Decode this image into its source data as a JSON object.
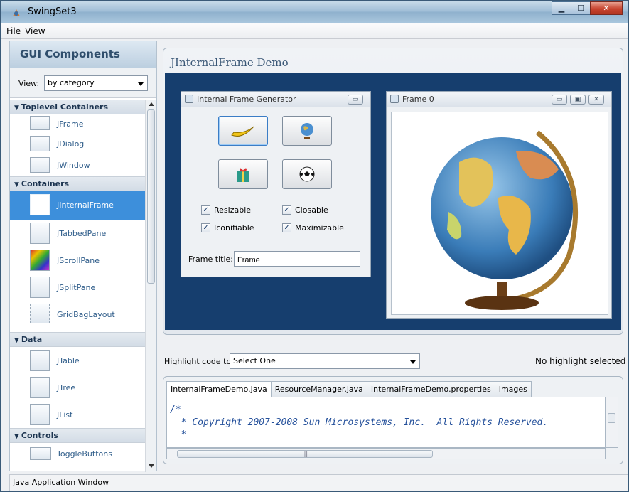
{
  "window": {
    "title": "SwingSet3"
  },
  "menu": [
    "File",
    "View"
  ],
  "sidebar": {
    "heading": "GUI Components",
    "view_label": "View:",
    "view_value": "by category",
    "categories": [
      {
        "label": "Toplevel Containers",
        "items": [
          "JFrame",
          "JDialog",
          "JWindow"
        ]
      },
      {
        "label": "Containers",
        "items": [
          "JInternalFrame",
          "JTabbedPane",
          "JScrollPane",
          "JSplitPane",
          "GridBagLayout"
        ]
      },
      {
        "label": "Data",
        "items": [
          "JTable",
          "JTree",
          "JList"
        ]
      },
      {
        "label": "Controls",
        "items": [
          "ToggleButtons"
        ]
      }
    ],
    "selected": "JInternalFrame"
  },
  "demo": {
    "title": "JInternalFrame Demo",
    "generator": {
      "title": "Internal Frame Generator",
      "buttons": [
        "banana-icon",
        "globe-icon",
        "gift-icon",
        "soccer-ball-icon"
      ],
      "checkboxes": {
        "resizable": {
          "label": "Resizable",
          "checked": true
        },
        "closable": {
          "label": "Closable",
          "checked": true
        },
        "iconifiable": {
          "label": "Iconifiable",
          "checked": true
        },
        "maximizable": {
          "label": "Maximizable",
          "checked": true
        }
      },
      "frame_title_label": "Frame title:",
      "frame_title_value": "Frame"
    },
    "frame0": {
      "title": "Frame 0",
      "image": "globe"
    }
  },
  "highlight": {
    "label": "Highlight code to:",
    "value": "Select One",
    "status": "No highlight selected"
  },
  "code": {
    "tabs": [
      "InternalFrameDemo.java",
      "ResourceManager.java",
      "InternalFrameDemo.properties",
      "Images"
    ],
    "active_tab": "InternalFrameDemo.java",
    "lines": [
      "/*",
      "  * Copyright 2007-2008 Sun Microsystems, Inc.  All Rights Reserved.",
      "  *"
    ]
  },
  "status": "Java Application Window"
}
